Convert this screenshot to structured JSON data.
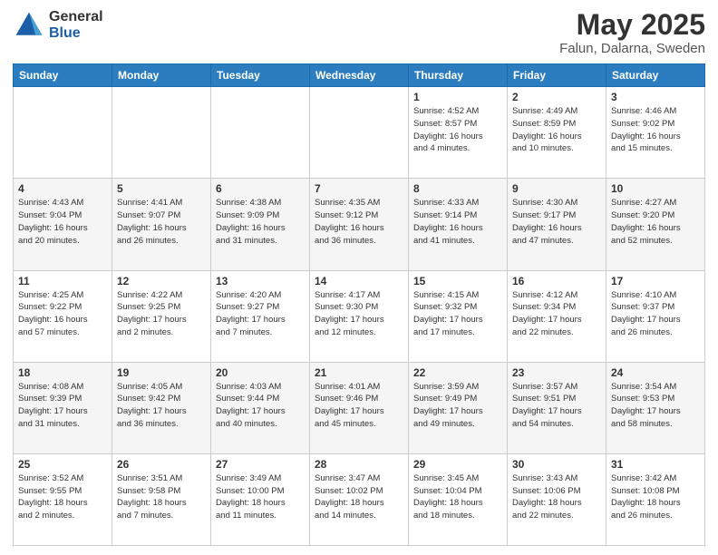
{
  "logo": {
    "general": "General",
    "blue": "Blue"
  },
  "title": "May 2025",
  "subtitle": "Falun, Dalarna, Sweden",
  "days_header": [
    "Sunday",
    "Monday",
    "Tuesday",
    "Wednesday",
    "Thursday",
    "Friday",
    "Saturday"
  ],
  "weeks": [
    [
      {
        "day": "",
        "info": ""
      },
      {
        "day": "",
        "info": ""
      },
      {
        "day": "",
        "info": ""
      },
      {
        "day": "",
        "info": ""
      },
      {
        "day": "1",
        "info": "Sunrise: 4:52 AM\nSunset: 8:57 PM\nDaylight: 16 hours\nand 4 minutes."
      },
      {
        "day": "2",
        "info": "Sunrise: 4:49 AM\nSunset: 8:59 PM\nDaylight: 16 hours\nand 10 minutes."
      },
      {
        "day": "3",
        "info": "Sunrise: 4:46 AM\nSunset: 9:02 PM\nDaylight: 16 hours\nand 15 minutes."
      }
    ],
    [
      {
        "day": "4",
        "info": "Sunrise: 4:43 AM\nSunset: 9:04 PM\nDaylight: 16 hours\nand 20 minutes."
      },
      {
        "day": "5",
        "info": "Sunrise: 4:41 AM\nSunset: 9:07 PM\nDaylight: 16 hours\nand 26 minutes."
      },
      {
        "day": "6",
        "info": "Sunrise: 4:38 AM\nSunset: 9:09 PM\nDaylight: 16 hours\nand 31 minutes."
      },
      {
        "day": "7",
        "info": "Sunrise: 4:35 AM\nSunset: 9:12 PM\nDaylight: 16 hours\nand 36 minutes."
      },
      {
        "day": "8",
        "info": "Sunrise: 4:33 AM\nSunset: 9:14 PM\nDaylight: 16 hours\nand 41 minutes."
      },
      {
        "day": "9",
        "info": "Sunrise: 4:30 AM\nSunset: 9:17 PM\nDaylight: 16 hours\nand 47 minutes."
      },
      {
        "day": "10",
        "info": "Sunrise: 4:27 AM\nSunset: 9:20 PM\nDaylight: 16 hours\nand 52 minutes."
      }
    ],
    [
      {
        "day": "11",
        "info": "Sunrise: 4:25 AM\nSunset: 9:22 PM\nDaylight: 16 hours\nand 57 minutes."
      },
      {
        "day": "12",
        "info": "Sunrise: 4:22 AM\nSunset: 9:25 PM\nDaylight: 17 hours\nand 2 minutes."
      },
      {
        "day": "13",
        "info": "Sunrise: 4:20 AM\nSunset: 9:27 PM\nDaylight: 17 hours\nand 7 minutes."
      },
      {
        "day": "14",
        "info": "Sunrise: 4:17 AM\nSunset: 9:30 PM\nDaylight: 17 hours\nand 12 minutes."
      },
      {
        "day": "15",
        "info": "Sunrise: 4:15 AM\nSunset: 9:32 PM\nDaylight: 17 hours\nand 17 minutes."
      },
      {
        "day": "16",
        "info": "Sunrise: 4:12 AM\nSunset: 9:34 PM\nDaylight: 17 hours\nand 22 minutes."
      },
      {
        "day": "17",
        "info": "Sunrise: 4:10 AM\nSunset: 9:37 PM\nDaylight: 17 hours\nand 26 minutes."
      }
    ],
    [
      {
        "day": "18",
        "info": "Sunrise: 4:08 AM\nSunset: 9:39 PM\nDaylight: 17 hours\nand 31 minutes."
      },
      {
        "day": "19",
        "info": "Sunrise: 4:05 AM\nSunset: 9:42 PM\nDaylight: 17 hours\nand 36 minutes."
      },
      {
        "day": "20",
        "info": "Sunrise: 4:03 AM\nSunset: 9:44 PM\nDaylight: 17 hours\nand 40 minutes."
      },
      {
        "day": "21",
        "info": "Sunrise: 4:01 AM\nSunset: 9:46 PM\nDaylight: 17 hours\nand 45 minutes."
      },
      {
        "day": "22",
        "info": "Sunrise: 3:59 AM\nSunset: 9:49 PM\nDaylight: 17 hours\nand 49 minutes."
      },
      {
        "day": "23",
        "info": "Sunrise: 3:57 AM\nSunset: 9:51 PM\nDaylight: 17 hours\nand 54 minutes."
      },
      {
        "day": "24",
        "info": "Sunrise: 3:54 AM\nSunset: 9:53 PM\nDaylight: 17 hours\nand 58 minutes."
      }
    ],
    [
      {
        "day": "25",
        "info": "Sunrise: 3:52 AM\nSunset: 9:55 PM\nDaylight: 18 hours\nand 2 minutes."
      },
      {
        "day": "26",
        "info": "Sunrise: 3:51 AM\nSunset: 9:58 PM\nDaylight: 18 hours\nand 7 minutes."
      },
      {
        "day": "27",
        "info": "Sunrise: 3:49 AM\nSunset: 10:00 PM\nDaylight: 18 hours\nand 11 minutes."
      },
      {
        "day": "28",
        "info": "Sunrise: 3:47 AM\nSunset: 10:02 PM\nDaylight: 18 hours\nand 14 minutes."
      },
      {
        "day": "29",
        "info": "Sunrise: 3:45 AM\nSunset: 10:04 PM\nDaylight: 18 hours\nand 18 minutes."
      },
      {
        "day": "30",
        "info": "Sunrise: 3:43 AM\nSunset: 10:06 PM\nDaylight: 18 hours\nand 22 minutes."
      },
      {
        "day": "31",
        "info": "Sunrise: 3:42 AM\nSunset: 10:08 PM\nDaylight: 18 hours\nand 26 minutes."
      }
    ]
  ]
}
